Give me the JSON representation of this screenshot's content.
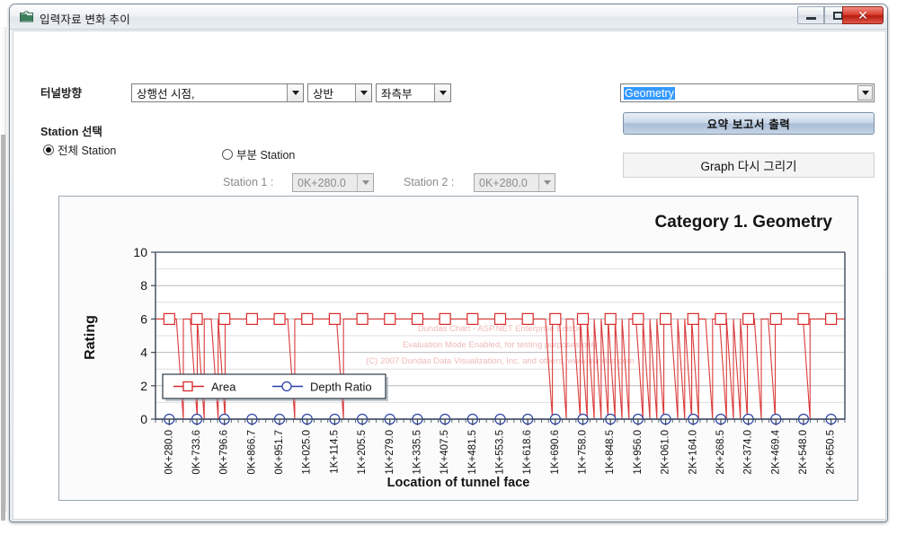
{
  "window": {
    "title": "입력자료 변화 추이",
    "icon": "folder-icon",
    "minimize_label": "–",
    "maximize_label": "□",
    "close_label": "✕"
  },
  "form": {
    "direction_label": "터널방향",
    "direction_value": "상행선 시점,",
    "half_value": "상반",
    "side_value": "좌측부",
    "station_section_label": "Station 선택",
    "radio_all_label": "전체 Station",
    "radio_part_label": "부분 Station",
    "radio_all_selected": true,
    "radio_part_selected": false,
    "station1_label": "Station 1 :",
    "station1_value": "0K+280.0",
    "station1_disabled": true,
    "station2_label": "Station 2 :",
    "station2_value": "0K+280.0",
    "station2_disabled": true,
    "category_value": "Geometry",
    "category_selected": true,
    "report_button_label": "요약 보고서 출력",
    "redraw_button_label": "Graph 다시 그리기"
  },
  "colors": {
    "area_series": "#d82a2a",
    "depth_series": "#2a3fa8",
    "selection_blue": "#3399ff",
    "close_button_red": "#c02718",
    "panel_border": "#9aa5ae",
    "watermark": "#f0b9b9"
  },
  "chart_data": {
    "type": "line",
    "title": "Category 1. Geometry",
    "xlabel": "Location of tunnel face",
    "ylabel": "Rating",
    "ylim": [
      0,
      10
    ],
    "yticks": [
      0,
      2,
      4,
      6,
      8,
      10
    ],
    "grid": true,
    "legend_position": "inside-bottom-left",
    "watermark": [
      "Dundas Chart - ASP.NET Enterprise Edition",
      "Evaluation Mode Enabled, for testing purposes only",
      "(C) 2007 Dundas Data Visualization, Inc. and others, www.dundas.com"
    ],
    "categories": [
      "0K+280.0",
      "0K+733.6",
      "0K+796.6",
      "0K+866.7",
      "0K+951.7",
      "1K+025.0",
      "1K+114.5",
      "1K+205.5",
      "1K+279.0",
      "1K+335.5",
      "1K+407.5",
      "1K+481.5",
      "1K+553.5",
      "1K+618.6",
      "1K+690.6",
      "1K+758.0",
      "1K+848.5",
      "1K+956.0",
      "2K+061.0",
      "2K+164.0",
      "2K+268.5",
      "2K+374.0",
      "2K+469.4",
      "2K+548.0",
      "2K+650.5"
    ],
    "series": [
      {
        "name": "Area",
        "color": "#d82a2a",
        "marker": "square",
        "baseline": 6,
        "values": [
          0,
          6,
          6,
          6,
          6,
          6,
          6,
          6,
          6,
          6,
          6,
          6,
          6,
          6,
          6,
          6,
          6,
          6,
          6,
          6,
          6,
          6,
          6,
          6,
          6,
          6,
          6,
          6,
          6,
          6,
          6,
          6,
          6,
          6,
          6,
          6,
          6,
          6,
          6,
          6,
          6,
          6,
          6,
          6,
          6,
          6,
          6,
          6,
          6,
          6
        ],
        "drop_indices": [
          0,
          4,
          6,
          7,
          9,
          10,
          20,
          27,
          57,
          59,
          61,
          62,
          63,
          64,
          65,
          66,
          67,
          68,
          70,
          71,
          72,
          73,
          75,
          76,
          77,
          78,
          80,
          82,
          83,
          84,
          85,
          87,
          89,
          94
        ]
      },
      {
        "name": "Depth Ratio",
        "color": "#2a3fa8",
        "marker": "circle",
        "baseline": 0,
        "values": [
          0,
          0,
          0,
          0,
          0,
          0,
          0,
          0,
          0,
          0,
          0,
          0,
          0,
          0,
          0,
          0,
          0,
          0,
          0,
          0,
          0,
          0,
          0,
          0,
          0
        ]
      }
    ],
    "legend": [
      {
        "label": "Area",
        "color": "#d82a2a",
        "marker": "square"
      },
      {
        "label": "Depth Ratio",
        "color": "#2a3fa8",
        "marker": "circle"
      }
    ]
  }
}
